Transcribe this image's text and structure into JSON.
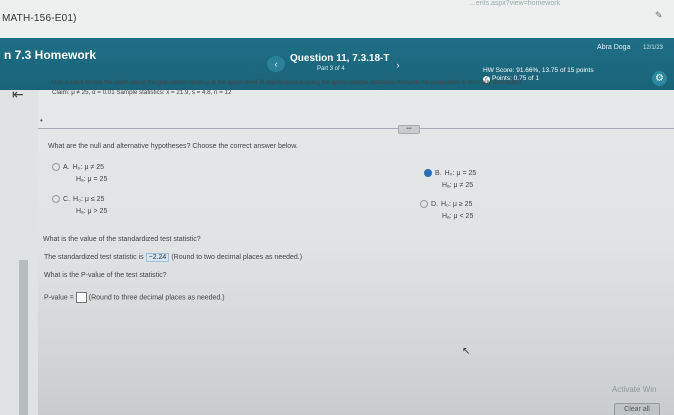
{
  "topbar": {
    "course": "MATH-156-E01)",
    "url_fragment": "...ents.aspx?view=homework"
  },
  "header": {
    "hw_title": "n 7.3 Homework",
    "question_title": "Question 11, 7.3.18-T",
    "part": "Part 3 of 4",
    "user": "Abra Doga",
    "date": "12/1/23",
    "score": "HW Score: 91.66%, 13.75 of 15 points",
    "points": "Points: 0.75 of 1",
    "prev_symbol": "‹",
    "next_symbol": "›"
  },
  "problem": {
    "line1": "Use a t-test to test the claim about the population mean μ at the given level of significance α using the given sample statistics. Assume the population is normally distributed.",
    "line2": "Claim: μ ≠ 25, α = 0.01   Sample statistics: x̄ = 21.9, s = 4.8, n = 12"
  },
  "q1": {
    "text": "What are the null and alternative hypotheses? Choose the correct answer below.",
    "options": [
      {
        "letter": "A.",
        "h0": "H₀: μ ≠ 25",
        "ha": "Hₐ: μ = 25",
        "selected": false
      },
      {
        "letter": "B.",
        "h0": "H₀: μ = 25",
        "ha": "Hₐ: μ ≠ 25",
        "selected": true
      },
      {
        "letter": "C.",
        "h0": "H₀: μ ≤ 25",
        "ha": "Hₐ: μ > 25",
        "selected": false
      },
      {
        "letter": "D.",
        "h0": "H₀: μ ≥ 25",
        "ha": "Hₐ: μ < 25",
        "selected": false
      }
    ]
  },
  "q2": {
    "text": "What is the value of the standardized test statistic?",
    "prefix": "The standardized test statistic is",
    "value": "−2.24",
    "suffix": "(Round to two decimal places as needed.)"
  },
  "q3": {
    "text": "What is the P-value of the test statistic?",
    "prefix": "P-value =",
    "suffix": "(Round to three decimal places as needed.)"
  },
  "footer": {
    "activate": "Activate Win",
    "clear_all": "Clear all"
  }
}
